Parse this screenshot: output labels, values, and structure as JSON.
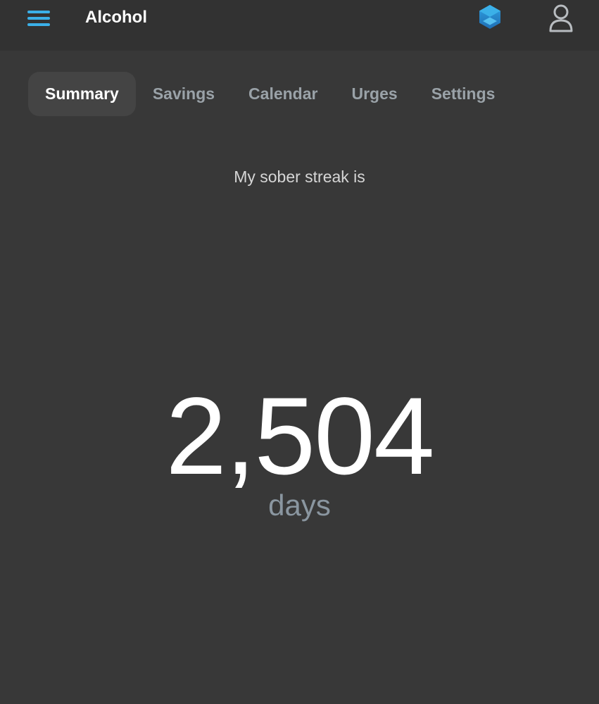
{
  "header": {
    "title": "Alcohol",
    "menu_icon": "hamburger-menu-icon",
    "hex_icon": "hexagon-logo-icon",
    "profile_icon": "user-profile-icon",
    "accent_color": "#3bb0e8"
  },
  "tabs": [
    {
      "label": "Summary",
      "active": true
    },
    {
      "label": "Savings",
      "active": false
    },
    {
      "label": "Calendar",
      "active": false
    },
    {
      "label": "Urges",
      "active": false
    },
    {
      "label": "Settings",
      "active": false
    }
  ],
  "summary": {
    "subtitle": "My sober streak is",
    "streak_value": "2,504",
    "streak_unit": "days"
  }
}
